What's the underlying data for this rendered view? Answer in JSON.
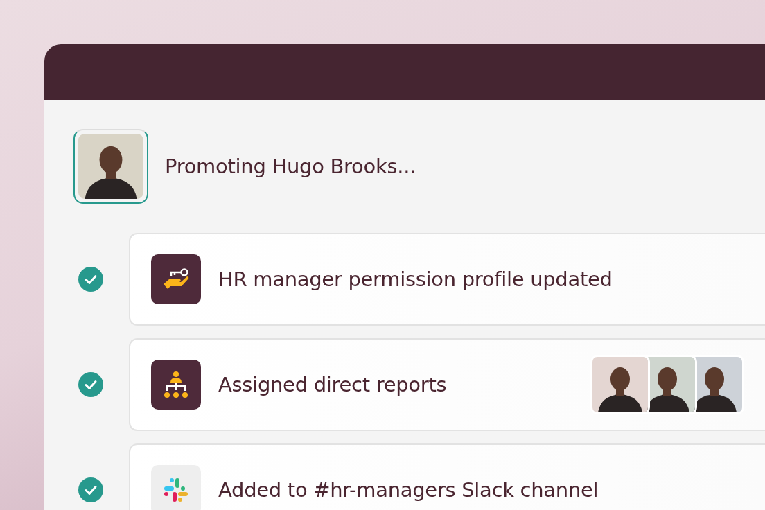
{
  "title": "Promoting Hugo Brooks...",
  "tasks": [
    {
      "kind": "permissions",
      "done": true,
      "label": "HR manager permission profile updated"
    },
    {
      "kind": "reports",
      "done": true,
      "label": "Assigned direct reports"
    },
    {
      "kind": "chat",
      "done": true,
      "label": "Added to #hr-managers Slack channel"
    }
  ]
}
